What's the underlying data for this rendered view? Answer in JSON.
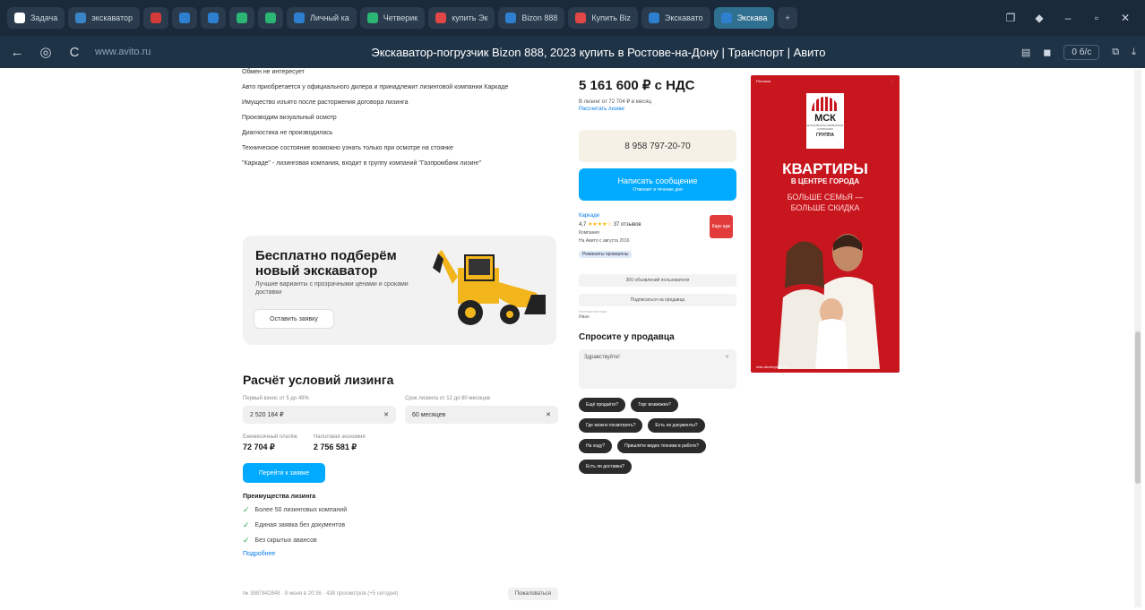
{
  "browser": {
    "tabs": [
      {
        "label": "Задача",
        "color": "#ffffff"
      },
      {
        "label": "экскаватор",
        "color": "#3a85c8"
      },
      {
        "label": "",
        "color": "#d33b3b"
      },
      {
        "label": "",
        "color": "#2e7fd0"
      },
      {
        "label": "",
        "color": "#2e7fd0"
      },
      {
        "label": "",
        "color": "#2bb673"
      },
      {
        "label": "",
        "color": "#2bb673"
      },
      {
        "label": "Личный ка",
        "color": "#2e7fd0"
      },
      {
        "label": "Четверик",
        "color": "#2bb673"
      },
      {
        "label": "купить Эк",
        "color": "#e04848"
      },
      {
        "label": "Bizon 888",
        "color": "#2e7fd0"
      },
      {
        "label": "Купить Biz",
        "color": "#e04848"
      },
      {
        "label": "Экскавато",
        "color": "#2e7fd0"
      },
      {
        "label": "Экскава",
        "color": "#2e7fd0"
      }
    ],
    "new_tab": "+",
    "domain": "www.avito.ru",
    "page_title": "Экскаватор-погрузчик Bizon 888, 2023 купить в Ростове-на-Дону | Транспорт | Авито",
    "traffic": "0 б/с",
    "back": "←",
    "reload": "C"
  },
  "description": {
    "lines": [
      "Обмен не интересует",
      "Авто приобретается у официального дилера и принадлежит лизинговой компании Каркаде",
      "Имущество изъято после расторжения договора лизинга",
      "Производим визуальный осмотр",
      "Диагностика не производилась",
      "Техническое состояние возможно узнать только при осмотре на стоянке",
      "\"Каркаде\" - лизинговая компания, входит в группу компаний \"Газпромбанк лизинг\""
    ]
  },
  "promo": {
    "title": "Бесплатно подберём новый экскаватор",
    "subtitle": "Лучшие варианты с прозрачными ценами и сроками доставки",
    "button": "Оставить заявку"
  },
  "leasing": {
    "title": "Расчёт условий лизинга",
    "prepayment_label": "Первый взнос от 5 до 49%",
    "prepayment_value": "2 520 184 ₽",
    "term_label": "Срок лизинга от 12 до 60 месяцев",
    "term_value": "60 месяцев",
    "clear": "✕",
    "monthly_label": "Ежемесячный платёж",
    "monthly_value": "72 704 ₽",
    "overpay_label": "Налоговая экономия",
    "overpay_value": "2 756 581 ₽",
    "button": "Перейти к заявке",
    "advantages_title": "Преимущества лизинга",
    "advantages": [
      "Более 50 лизинговых компаний",
      "Единая заявка без документов",
      "Без скрытых авансов"
    ],
    "more": "Подробнее"
  },
  "footer": {
    "text": "№ 3887842848 · 8 июня в 20:36 · 438 просмотров (+5 сегодня)",
    "button": "Пожаловаться"
  },
  "sidebar": {
    "price": "5 161 600 ₽ с НДС",
    "price_sub": "В лизинг от 72 704 ₽ в месяц",
    "price_link": "Рассчитать лизинг",
    "phone": "8 958 797-20-70",
    "message_button": "Написать сообщение",
    "message_sub": "Отвечает в течение дня",
    "seller_name": "Каркаде",
    "seller_rating": "4,7",
    "seller_stars": "★★★★☆",
    "seller_reviews": "37 отзывов",
    "seller_type": "Компания",
    "seller_since": "На Авито с августа 2016",
    "seller_badge": "Реквизиты проверены",
    "seller_logo": "Карк аде",
    "btn_listings": "300 объявлений пользователя",
    "btn_subscribe": "Подписаться на продавца",
    "contact_person_label": "Контактное лицо",
    "contact_person": "Иван"
  },
  "ask": {
    "title": "Спросите у продавца",
    "placeholder": "Здравствуйте!",
    "clear": "✕",
    "chips": [
      "Ещё продаёте?",
      "Торг возможен?",
      "Где можно посмотреть?",
      "Есть ли документы?",
      "На ходу?",
      "Пришлёте видео техники в работе?",
      "Есть ли доставка?"
    ]
  },
  "ad": {
    "label": "Реклама",
    "logo_main": "МСК",
    "logo_line": "МОСКОВСКАЯ СЕРВИСНАЯ КОМПАНИЯ",
    "logo_group": "ГРУППА",
    "headline": "КВАРТИРЫ",
    "headline2": "В ЦЕНТРЕ ГОРОДА",
    "tagline1": "БОЛЬШЕ СЕМЬЯ —",
    "tagline2": "БОЛЬШЕ СКИДКА",
    "bottom": "msk-development.ru"
  },
  "colors": {
    "accent": "#00aaff",
    "ad_bg": "#c8161e",
    "chrome_bg": "#1b2a3a"
  }
}
